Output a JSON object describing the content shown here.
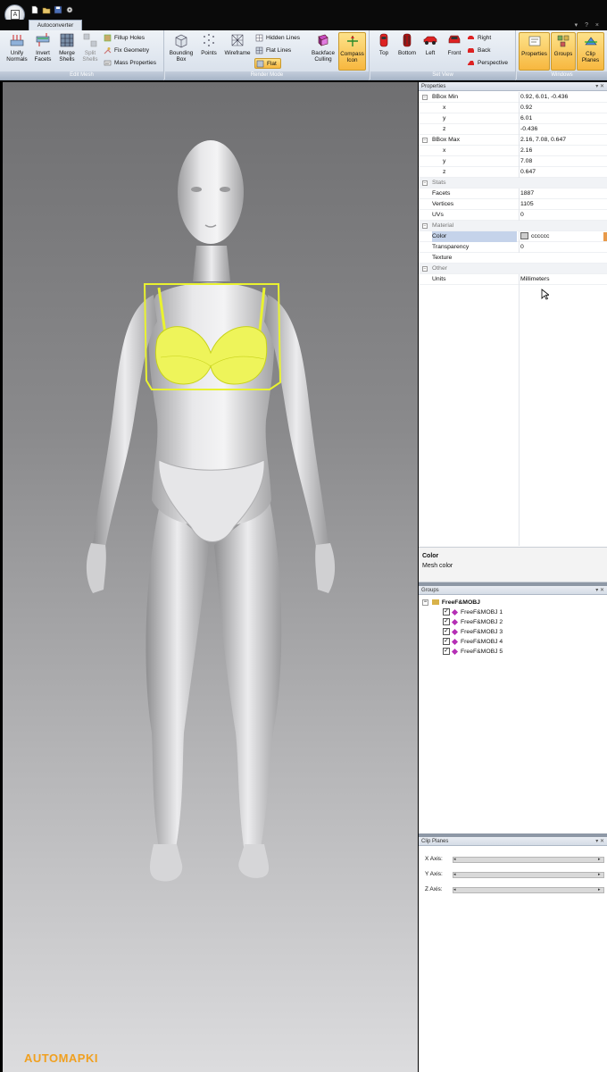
{
  "ribbon": {
    "tab": "Autoconverter",
    "edit_mesh": {
      "label": "Edit Mesh",
      "unify_normals": "Unify Normals",
      "invert_facets": "Invert Facets",
      "merge_shells": "Merge Shells",
      "split_shells": "Split Shells",
      "fillup_holes": "Fillup Holes",
      "fix_geometry": "Fix Geometry",
      "mass_properties": "Mass Properties"
    },
    "render_mode": {
      "label": "Render Mode",
      "bounding_box": "Bounding Box",
      "points": "Points",
      "wireframe": "Wireframe",
      "hidden_lines": "Hidden Lines",
      "flat_lines": "Flat Lines",
      "flat": "Flat",
      "backface_culling": "Backface Culling",
      "compass_icon": "Compass Icon"
    },
    "set_view": {
      "label": "Set View",
      "top": "Top",
      "bottom": "Bottom",
      "left": "Left",
      "front": "Front",
      "right": "Right",
      "back": "Back",
      "perspective": "Perspective"
    },
    "windows": {
      "label": "Windows",
      "properties": "Properties",
      "groups": "Groups",
      "clip_planes": "Clip Planes"
    }
  },
  "properties": {
    "title": "Properties",
    "bbox_min": {
      "label": "BBox Min",
      "value": "0.92, 6.01, -0.436",
      "x": "0.92",
      "y": "6.01",
      "z": "-0.436"
    },
    "bbox_max": {
      "label": "BBox Max",
      "value": "2.16, 7.08, 0.647",
      "x": "2.16",
      "y": "7.08",
      "z": "0.647"
    },
    "axis_x": "x",
    "axis_y": "y",
    "axis_z": "z",
    "stats": {
      "label": "Stats",
      "facets_label": "Facets",
      "facets": "1887",
      "vertices_label": "Vertices",
      "vertices": "1105",
      "uvs_label": "UVs",
      "uvs": "0"
    },
    "material": {
      "label": "Material",
      "color_label": "Color",
      "color_value": "cccccc",
      "transparency_label": "Transparency",
      "transparency": "0",
      "texture_label": "Texture"
    },
    "other": {
      "label": "Other",
      "units_label": "Units",
      "units": "Millimeters"
    },
    "help_title": "Color",
    "help_text": "Mesh color"
  },
  "groups": {
    "title": "Groups",
    "root": "FreeF&MOBJ",
    "items": [
      "FreeF&MOBJ 1",
      "FreeF&MOBJ 2",
      "FreeF&MOBJ 3",
      "FreeF&MOBJ 4",
      "FreeF&MOBJ 5"
    ]
  },
  "clip_planes": {
    "title": "Clip Planes",
    "x_axis": "X Axis:",
    "y_axis": "Y Axis:",
    "z_axis": "Z Axis:"
  },
  "watermark": "AUTOMAPKI",
  "colors": {
    "accent": "#f7b73f",
    "selection": "#e9f230",
    "mesh": "#cccccc",
    "watermark": "#f0a020"
  }
}
